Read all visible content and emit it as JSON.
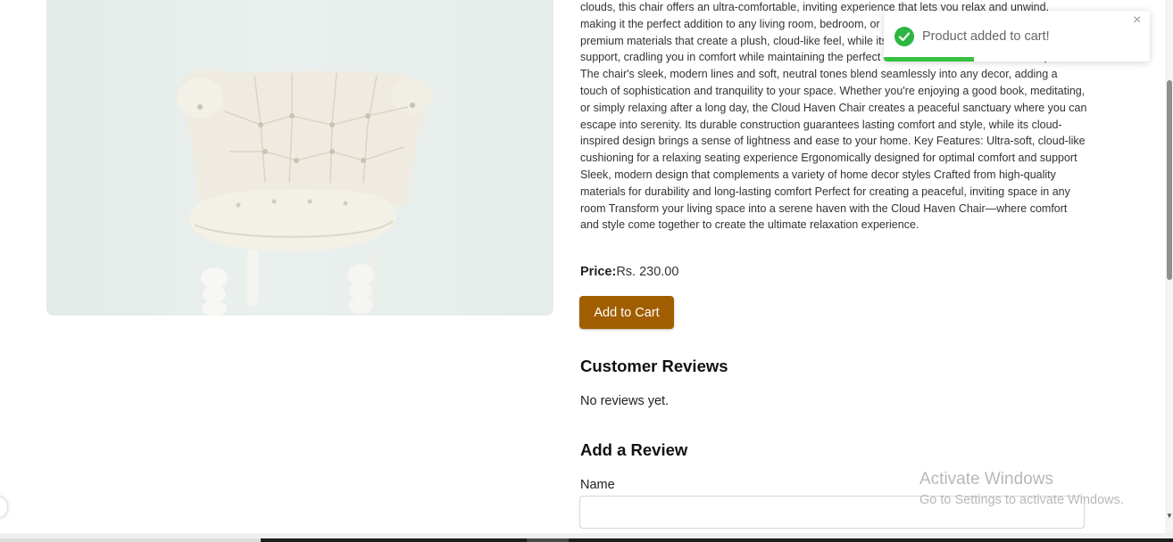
{
  "product": {
    "image_alt": "White tufted armchair",
    "description": "clouds, this chair offers an ultra-comfortable, inviting experience that lets you relax and unwind, making it the perfect addition to any living room, bedroom, or reading nook. The chair is crafted with premium materials that create a plush, cloud-like feel, while its ergonomic cushioning provides gentle support, cradling you in comfort while maintaining the perfect balance between relaxation and posture. The chair's sleek, modern lines and soft, neutral tones blend seamlessly into any decor, adding a touch of sophistication and tranquility to your space. Whether you're enjoying a good book, meditating, or simply relaxing after a long day, the Cloud Haven Chair creates a peaceful sanctuary where you can escape into serenity. Its durable construction guarantees lasting comfort and style, while its cloud-inspired design brings a sense of lightness and ease to your home. Key Features: Ultra-soft, cloud-like cushioning for a relaxing seating experience Ergonomically designed for optimal comfort and support Sleek, modern design that complements a variety of home decor styles Crafted from high-quality materials for durability and long-lasting comfort Perfect for creating a peaceful, inviting space in any room Transform your living space into a serene haven with the Cloud Haven Chair—where comfort and style come together to create the ultimate relaxation experience.",
    "price_label": "Price:",
    "price_value": "Rs. 230.00",
    "add_to_cart_label": "Add to Cart",
    "button_color": "#a15e00"
  },
  "reviews": {
    "heading": "Customer Reviews",
    "empty_text": "No reviews yet."
  },
  "add_review": {
    "heading": "Add a Review",
    "name_label": "Name",
    "name_value": ""
  },
  "toast": {
    "message": "Product added to cart!",
    "close_symbol": "×",
    "icon": "check-circle-icon",
    "accent_color": "#35c13f",
    "progress_fraction": 0.34
  },
  "watermark": {
    "title": "Activate Windows",
    "subtitle": "Go to Settings to activate Windows."
  }
}
